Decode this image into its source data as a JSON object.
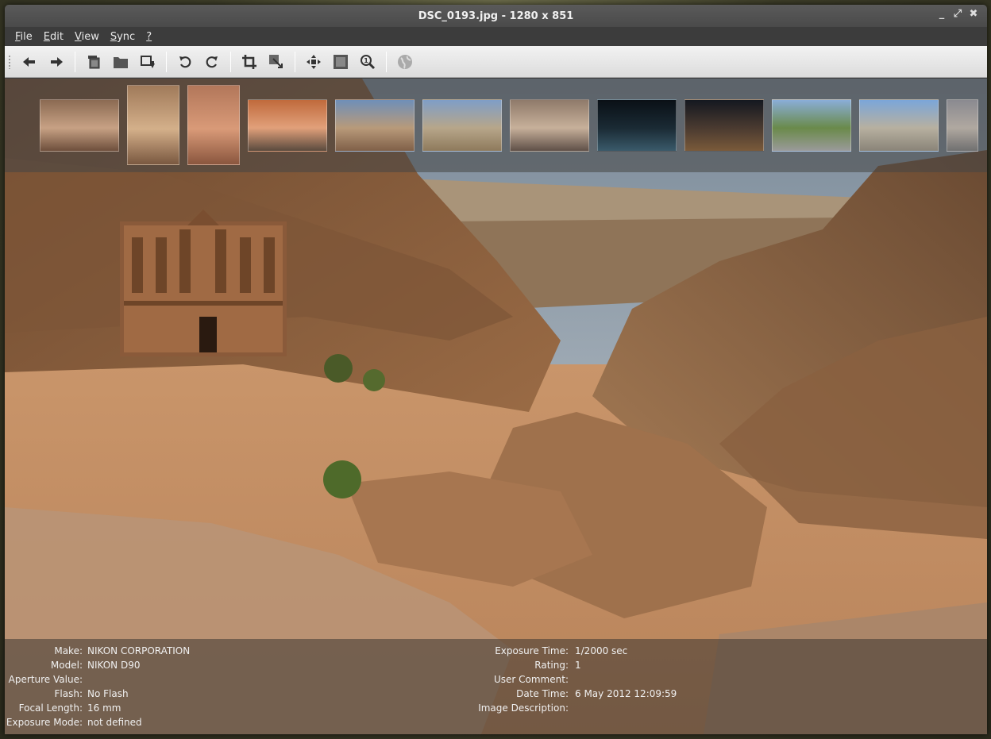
{
  "window": {
    "title": "DSC_0193.jpg - 1280 x 851",
    "controls": [
      "_",
      "⤢",
      "✖"
    ]
  },
  "menu": [
    {
      "label": "File",
      "key": "F",
      "rest": "ile"
    },
    {
      "label": "Edit",
      "key": "E",
      "rest": "dit"
    },
    {
      "label": "View",
      "key": "V",
      "rest": "iew"
    },
    {
      "label": "Sync",
      "key": "S",
      "rest": "ync"
    },
    {
      "label": "?",
      "key": "?",
      "rest": ""
    }
  ],
  "toolbar": {
    "icons": [
      "back-arrow-icon",
      "forward-arrow-icon",
      "copy-icon",
      "folder-icon",
      "move-to-icon",
      "rotate-left-icon",
      "rotate-right-icon",
      "crop-icon",
      "resize-icon",
      "fit-icon",
      "fullscreen-icon",
      "zoom-100-icon",
      "browser-globe-icon"
    ]
  },
  "thumbnails": [
    {
      "name": "thumb-petra-tomb",
      "colors": [
        "#8b6a52",
        "#c7a184",
        "#6e4f3c"
      ],
      "tall": false
    },
    {
      "name": "thumb-petra-cliff",
      "colors": [
        "#a07a5a",
        "#d4b08a",
        "#7a5840"
      ],
      "tall": true
    },
    {
      "name": "thumb-treasury",
      "colors": [
        "#b2775a",
        "#d99a78",
        "#8a563e"
      ],
      "tall": true
    },
    {
      "name": "thumb-siq-people",
      "colors": [
        "#c06a3c",
        "#e1a07a",
        "#5a4a3e"
      ],
      "tall": false
    },
    {
      "name": "thumb-rocks-sky",
      "colors": [
        "#6f8fb8",
        "#b89a7a",
        "#806048"
      ],
      "tall": false
    },
    {
      "name": "thumb-valley",
      "colors": [
        "#7f9ec7",
        "#b7a68a",
        "#8e7a5c"
      ],
      "tall": false
    },
    {
      "name": "thumb-town",
      "colors": [
        "#8f7a6a",
        "#c7b09a",
        "#5f5048"
      ],
      "tall": false
    },
    {
      "name": "thumb-night-1",
      "colors": [
        "#0a1016",
        "#1a2a34",
        "#3a5a6a"
      ],
      "tall": false
    },
    {
      "name": "thumb-night-2",
      "colors": [
        "#141820",
        "#4a3a30",
        "#7a5a3a"
      ],
      "tall": false
    },
    {
      "name": "thumb-road-trees",
      "colors": [
        "#8aaed8",
        "#6a8a4a",
        "#9a9a9a"
      ],
      "tall": false
    },
    {
      "name": "thumb-street",
      "colors": [
        "#7ba6d9",
        "#b7b0a0",
        "#8a8478"
      ],
      "tall": false
    },
    {
      "name": "thumb-partial",
      "colors": [
        "#8a8a90",
        "#b0a8a0",
        "#707070"
      ],
      "tall": false
    }
  ],
  "exif_left": [
    {
      "label": "Make:",
      "value": "NIKON CORPORATION"
    },
    {
      "label": "Model:",
      "value": "NIKON D90"
    },
    {
      "label": "Aperture Value:",
      "value": ""
    },
    {
      "label": "Flash:",
      "value": "No Flash"
    },
    {
      "label": "Focal Length:",
      "value": "16 mm"
    },
    {
      "label": "Exposure Mode:",
      "value": "not defined"
    }
  ],
  "exif_right": [
    {
      "label": "Exposure Time:",
      "value": "1/2000 sec"
    },
    {
      "label": "Rating:",
      "value": "1"
    },
    {
      "label": "User Comment:",
      "value": ""
    },
    {
      "label": "Date Time:",
      "value": "6 May 2012 12:09:59"
    },
    {
      "label": "Image Description:",
      "value": ""
    }
  ]
}
